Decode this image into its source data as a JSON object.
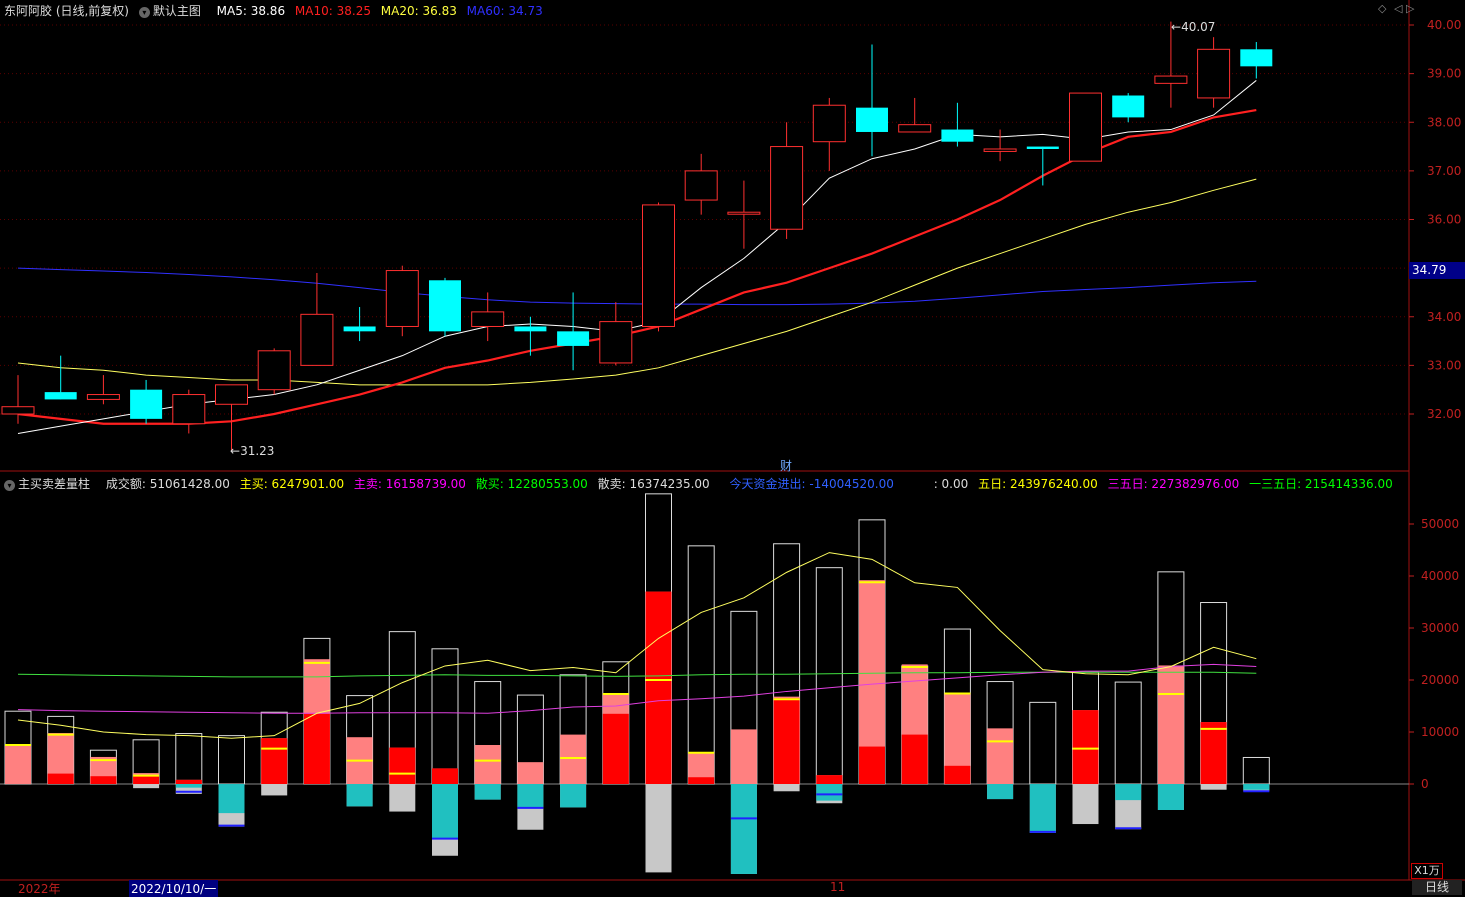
{
  "header_top": {
    "title": "东阿阿胶 (日线,前复权)",
    "main_chart": "默认主图",
    "ma5": "MA5: 38.86",
    "ma10": "MA10: 38.25",
    "ma20": "MA20: 36.83",
    "ma60": "MA60: 34.73"
  },
  "header_bottom": {
    "indicator": "主买卖差量柱",
    "turnover": "成交额: 51061428.00",
    "main_buy": "主买: 6247901.00",
    "main_sell": "主卖: 16158739.00",
    "retail_buy": "散买: 12280553.00",
    "retail_sell": "散卖: 16374235.00",
    "today_flow": "今天资金进出: -14004520.00",
    "zero": ": 0.00",
    "five_day": "五日: 243976240.00",
    "three_five": "三五日: 227382976.00",
    "one_three_five": "一三五日: 215414336.00"
  },
  "labels": {
    "high_mark": "40.07",
    "low_mark": "31.23",
    "cai": "财",
    "price_tag": "34.79",
    "unit": "X1万",
    "period": "日线",
    "date_year": "2022年",
    "date_cursor": "2022/10/10/一",
    "date_month": "11"
  },
  "colors": {
    "up": "#ff3030",
    "down": "#00ffff",
    "ma5": "#ffffff",
    "ma10": "#ff2020",
    "ma20": "#ffff60",
    "ma60": "#3030ff",
    "main_buy": "#ffff00",
    "main_sell": "#ff00ff",
    "retail_buy": "#00ff00"
  },
  "chart_data": [
    {
      "type": "candlestick",
      "yticks": [
        32.0,
        33.0,
        34.0,
        35.0,
        36.0,
        37.0,
        38.0,
        39.0,
        40.0
      ],
      "ytick_labels": [
        "32.00",
        "33.00",
        "34.00",
        "35.00",
        "36.00",
        "37.00",
        "38.00",
        "39.00",
        "40.00"
      ],
      "ylim": [
        31.0,
        40.2
      ],
      "candles": [
        {
          "o": 32.0,
          "h": 32.8,
          "l": 31.8,
          "c": 32.15
        },
        {
          "o": 32.45,
          "h": 33.2,
          "l": 32.3,
          "c": 32.3
        },
        {
          "o": 32.3,
          "h": 32.8,
          "l": 32.2,
          "c": 32.4
        },
        {
          "o": 32.5,
          "h": 32.7,
          "l": 31.8,
          "c": 31.9
        },
        {
          "o": 31.8,
          "h": 32.5,
          "l": 31.6,
          "c": 32.4
        },
        {
          "o": 32.2,
          "h": 32.6,
          "l": 31.23,
          "c": 32.6
        },
        {
          "o": 32.5,
          "h": 33.35,
          "l": 32.4,
          "c": 33.3
        },
        {
          "o": 33.0,
          "h": 34.9,
          "l": 33.0,
          "c": 34.05
        },
        {
          "o": 33.8,
          "h": 34.2,
          "l": 33.5,
          "c": 33.7
        },
        {
          "o": 33.8,
          "h": 35.05,
          "l": 33.6,
          "c": 34.95
        },
        {
          "o": 34.75,
          "h": 34.8,
          "l": 33.6,
          "c": 33.7
        },
        {
          "o": 33.8,
          "h": 34.5,
          "l": 33.5,
          "c": 34.1
        },
        {
          "o": 33.8,
          "h": 34.0,
          "l": 33.2,
          "c": 33.7
        },
        {
          "o": 33.7,
          "h": 34.5,
          "l": 32.9,
          "c": 33.4
        },
        {
          "o": 33.05,
          "h": 34.3,
          "l": 33.0,
          "c": 33.9
        },
        {
          "o": 33.8,
          "h": 36.35,
          "l": 33.7,
          "c": 36.3
        },
        {
          "o": 36.4,
          "h": 37.35,
          "l": 36.1,
          "c": 37.0
        },
        {
          "o": 36.15,
          "h": 36.8,
          "l": 35.4,
          "c": 36.15
        },
        {
          "o": 35.8,
          "h": 38.0,
          "l": 35.6,
          "c": 37.5
        },
        {
          "o": 37.6,
          "h": 38.5,
          "l": 37.0,
          "c": 38.35
        },
        {
          "o": 38.3,
          "h": 39.6,
          "l": 37.3,
          "c": 37.8
        },
        {
          "o": 37.8,
          "h": 38.5,
          "l": 37.8,
          "c": 37.95
        },
        {
          "o": 37.85,
          "h": 38.4,
          "l": 37.5,
          "c": 37.6
        },
        {
          "o": 37.4,
          "h": 37.85,
          "l": 37.2,
          "c": 37.45
        },
        {
          "o": 37.5,
          "h": 37.5,
          "l": 36.7,
          "c": 37.45
        },
        {
          "o": 37.2,
          "h": 38.6,
          "l": 37.2,
          "c": 38.6
        },
        {
          "o": 38.55,
          "h": 38.6,
          "l": 38.0,
          "c": 38.1
        },
        {
          "o": 38.8,
          "h": 40.07,
          "l": 38.3,
          "c": 38.95
        },
        {
          "o": 38.5,
          "h": 39.75,
          "l": 38.3,
          "c": 39.5
        },
        {
          "o": 39.5,
          "h": 39.65,
          "l": 38.9,
          "c": 39.15
        }
      ],
      "ma5": [
        31.6,
        31.75,
        31.9,
        32.05,
        32.2,
        32.3,
        32.4,
        32.6,
        32.9,
        33.2,
        33.6,
        33.8,
        33.85,
        33.8,
        33.7,
        33.9,
        34.6,
        35.2,
        35.95,
        36.85,
        37.25,
        37.45,
        37.75,
        37.7,
        37.75,
        37.65,
        37.8,
        37.85,
        38.15,
        38.86
      ],
      "ma10": [
        32.0,
        31.9,
        31.8,
        31.8,
        31.8,
        31.85,
        32.0,
        32.2,
        32.4,
        32.65,
        32.95,
        33.1,
        33.3,
        33.45,
        33.6,
        33.8,
        34.15,
        34.5,
        34.7,
        35.0,
        35.3,
        35.65,
        36.0,
        36.4,
        36.9,
        37.35,
        37.7,
        37.8,
        38.1,
        38.25
      ],
      "ma20": [
        33.05,
        32.95,
        32.9,
        32.8,
        32.75,
        32.7,
        32.7,
        32.65,
        32.6,
        32.6,
        32.6,
        32.6,
        32.65,
        32.72,
        32.8,
        32.95,
        33.2,
        33.45,
        33.7,
        34.0,
        34.3,
        34.65,
        35.0,
        35.3,
        35.6,
        35.9,
        36.15,
        36.35,
        36.6,
        36.83
      ],
      "ma60": [
        35.0,
        34.97,
        34.94,
        34.91,
        34.87,
        34.82,
        34.76,
        34.69,
        34.6,
        34.5,
        34.42,
        34.35,
        34.3,
        34.28,
        34.27,
        34.26,
        34.26,
        34.25,
        34.25,
        34.26,
        34.28,
        34.32,
        34.38,
        34.45,
        34.52,
        34.56,
        34.6,
        34.65,
        34.7,
        34.73
      ]
    },
    {
      "type": "bar",
      "yticks": [
        0,
        10000,
        20000,
        30000,
        40000,
        50000
      ],
      "ytick_labels": [
        "0",
        "10000",
        "20000",
        "30000",
        "40000",
        "50000"
      ],
      "ylim": [
        -17500,
        56000
      ],
      "turnover": [
        14000,
        13000,
        6500,
        8500,
        9700,
        9300,
        13800,
        28000,
        17000,
        29300,
        26000,
        19700,
        17100,
        21000,
        23500,
        55800,
        45800,
        33200,
        46200,
        41600,
        50800,
        22700,
        29800,
        19700,
        15700,
        21500,
        19600,
        40800,
        34900,
        5100
      ],
      "buy_total": [
        7600,
        9800,
        5200,
        2100,
        800,
        0,
        8800,
        24000,
        9000,
        7000,
        3000,
        7500,
        4200,
        9500,
        17500,
        37000,
        6000,
        10500,
        16800,
        1700,
        39200,
        23000,
        17500,
        10700,
        0,
        14200,
        0,
        22800,
        11900,
        0
      ],
      "buy_main": [
        0,
        2000,
        1500,
        1600,
        800,
        0,
        8800,
        13500,
        0,
        7000,
        3000,
        0,
        0,
        0,
        13500,
        37000,
        1300,
        0,
        16500,
        1700,
        7200,
        9500,
        3500,
        0,
        0,
        14200,
        0,
        0,
        11900,
        0
      ],
      "sell_neg": [
        0,
        0,
        0,
        -800,
        -1900,
        -8200,
        -2200,
        0,
        -4300,
        -5300,
        -13800,
        -3000,
        -8800,
        -4500,
        0,
        -17000,
        0,
        -17300,
        -1400,
        -3700,
        0,
        0,
        0,
        -2900,
        -9400,
        -7700,
        -8700,
        -5000,
        -1100,
        -1400
      ],
      "sell_main": [
        0,
        0,
        0,
        0,
        -700,
        -5600,
        0,
        0,
        -4300,
        0,
        -10400,
        -3000,
        -4500,
        -4500,
        0,
        0,
        0,
        -17300,
        0,
        -3200,
        0,
        0,
        0,
        -2900,
        -9400,
        0,
        -3100,
        -5000,
        0,
        -1100
      ],
      "marks": [
        7500,
        9500,
        4600,
        1600,
        -1500,
        -8000,
        6800,
        23300,
        4500,
        2000,
        -10500,
        4500,
        -4600,
        5000,
        17300,
        20000,
        6000,
        -6600,
        16300,
        -2000,
        38800,
        22500,
        17400,
        8200,
        -9200,
        6800,
        -8500,
        17300,
        10600,
        -1400
      ],
      "line_yellow": [
        12300,
        11300,
        10000,
        9500,
        9300,
        8800,
        9300,
        13600,
        15500,
        19500,
        22700,
        23800,
        21800,
        22400,
        21400,
        28000,
        33000,
        35800,
        40700,
        44500,
        43200,
        38700,
        37800,
        29500,
        22000,
        21200,
        21000,
        22600,
        26300,
        24100
      ],
      "line_magenta": [
        14300,
        14100,
        14000,
        13900,
        13800,
        13700,
        13600,
        13600,
        13700,
        13700,
        13700,
        13600,
        14100,
        14800,
        15000,
        16000,
        16400,
        16900,
        17800,
        18500,
        19200,
        19800,
        20400,
        21000,
        21500,
        21700,
        21700,
        22600,
        23000,
        22600
      ],
      "line_green": [
        21100,
        21000,
        20900,
        20800,
        20700,
        20600,
        20600,
        20600,
        20800,
        20900,
        21000,
        20900,
        20900,
        20800,
        20700,
        20800,
        21000,
        21100,
        21100,
        21200,
        21300,
        21400,
        21400,
        21500,
        21500,
        21500,
        21500,
        21500,
        21500,
        21300
      ]
    }
  ]
}
